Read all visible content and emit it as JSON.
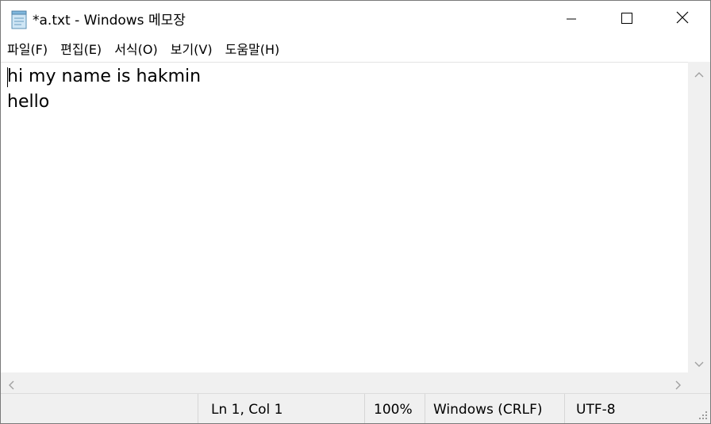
{
  "window": {
    "title": "*a.txt - Windows 메모장"
  },
  "icons": {
    "app": "notepad-icon",
    "minimize": "minimize-icon",
    "maximize": "maximize-icon",
    "close": "close-icon"
  },
  "menu": {
    "items": [
      {
        "label": "파일(F)"
      },
      {
        "label": "편집(E)"
      },
      {
        "label": "서식(O)"
      },
      {
        "label": "보기(V)"
      },
      {
        "label": "도움말(H)"
      }
    ]
  },
  "editor": {
    "lines": [
      "hi my name is hakmin",
      "hello"
    ]
  },
  "status": {
    "position": "Ln 1, Col 1",
    "zoom": "100%",
    "line_ending": "Windows (CRLF)",
    "encoding": "UTF-8"
  }
}
